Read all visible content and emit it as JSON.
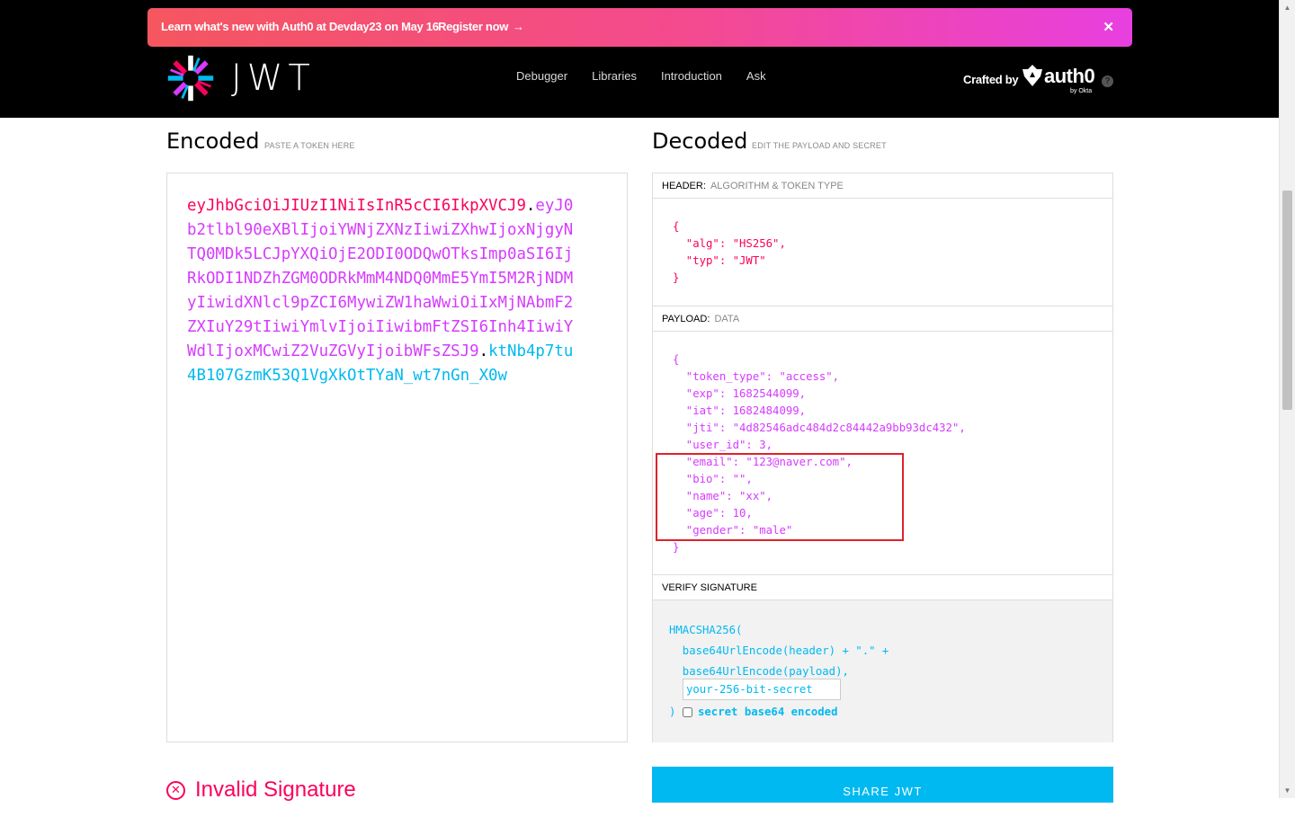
{
  "promo": {
    "text": "Learn what's new with Auth0 at Devday23 on May 16",
    "link": "Register now",
    "arrow": "→",
    "close": "✕"
  },
  "brand": {
    "logo_text": "JWT"
  },
  "nav": [
    "Debugger",
    "Libraries",
    "Introduction",
    "Ask"
  ],
  "crafted": {
    "label": "Crafted by",
    "brand": "auth0",
    "byline": "by Okta",
    "help": "?"
  },
  "encoded": {
    "title": "Encoded",
    "subtitle": "PASTE A TOKEN HERE",
    "header": "eyJhbGciOiJIUzI1NiIsInR5cCI6IkpXVCJ9",
    "payload": "eyJ0b2tlbl90eXBlIjoiYWNjZXNzIiwiZXhwIjoxNjgyNTQ0MDk5LCJpYXQiOjE2ODI0ODQwOTksImp0aSI6IjRkODI1NDZhZGM0ODRkMmM4NDQ0MmE5YmI5M2RjNDMyIiwidXNlcl9pZCI6MywiZW1haWwiOiIxMjNAbmF2ZXIuY29tIiwiYmlvIjoiIiwibmFtZSI6Inh4IiwiYWdlIjoxMCwiZ2VuZGVyIjoibWFsZSJ9",
    "signature": "ktNb4p7tu4B107GzmK53Q1VgXkOtTYaN_wt7nGn_X0w",
    "dot": "."
  },
  "decoded": {
    "title": "Decoded",
    "subtitle": "EDIT THE PAYLOAD AND SECRET",
    "header_label": "HEADER:",
    "header_sub": "ALGORITHM & TOKEN TYPE",
    "header_lines": [
      "{",
      "  \"alg\": \"HS256\",",
      "  \"typ\": \"JWT\"",
      "}"
    ],
    "payload_label": "PAYLOAD:",
    "payload_sub": "DATA",
    "payload_lines": [
      "{",
      "  \"token_type\": \"access\",",
      "  \"exp\": 1682544099,",
      "  \"iat\": 1682484099,",
      "  \"jti\": \"4d82546adc484d2c84442a9bb93dc432\",",
      "  \"user_id\": 3,",
      "  \"email\": \"123@naver.com\",",
      "  \"bio\": \"\",",
      "  \"name\": \"xx\",",
      "  \"age\": 10,",
      "  \"gender\": \"male\"",
      "}"
    ],
    "verify_label": "VERIFY SIGNATURE",
    "verify_lines": [
      "HMACSHA256(",
      "  base64UrlEncode(header) + \".\" +",
      "  base64UrlEncode(payload),"
    ],
    "secret_placeholder": "your-256-bit-secret",
    "close_paren": ")",
    "b64_label": "secret base64 encoded"
  },
  "status": {
    "invalid": "Invalid Signature",
    "invalid_icon": "✕"
  },
  "share_button": "SHARE JWT",
  "colors": {
    "header": "#fb015b",
    "payload": "#d63aff",
    "signature": "#00b9f1",
    "highlight": "#e0212a"
  }
}
